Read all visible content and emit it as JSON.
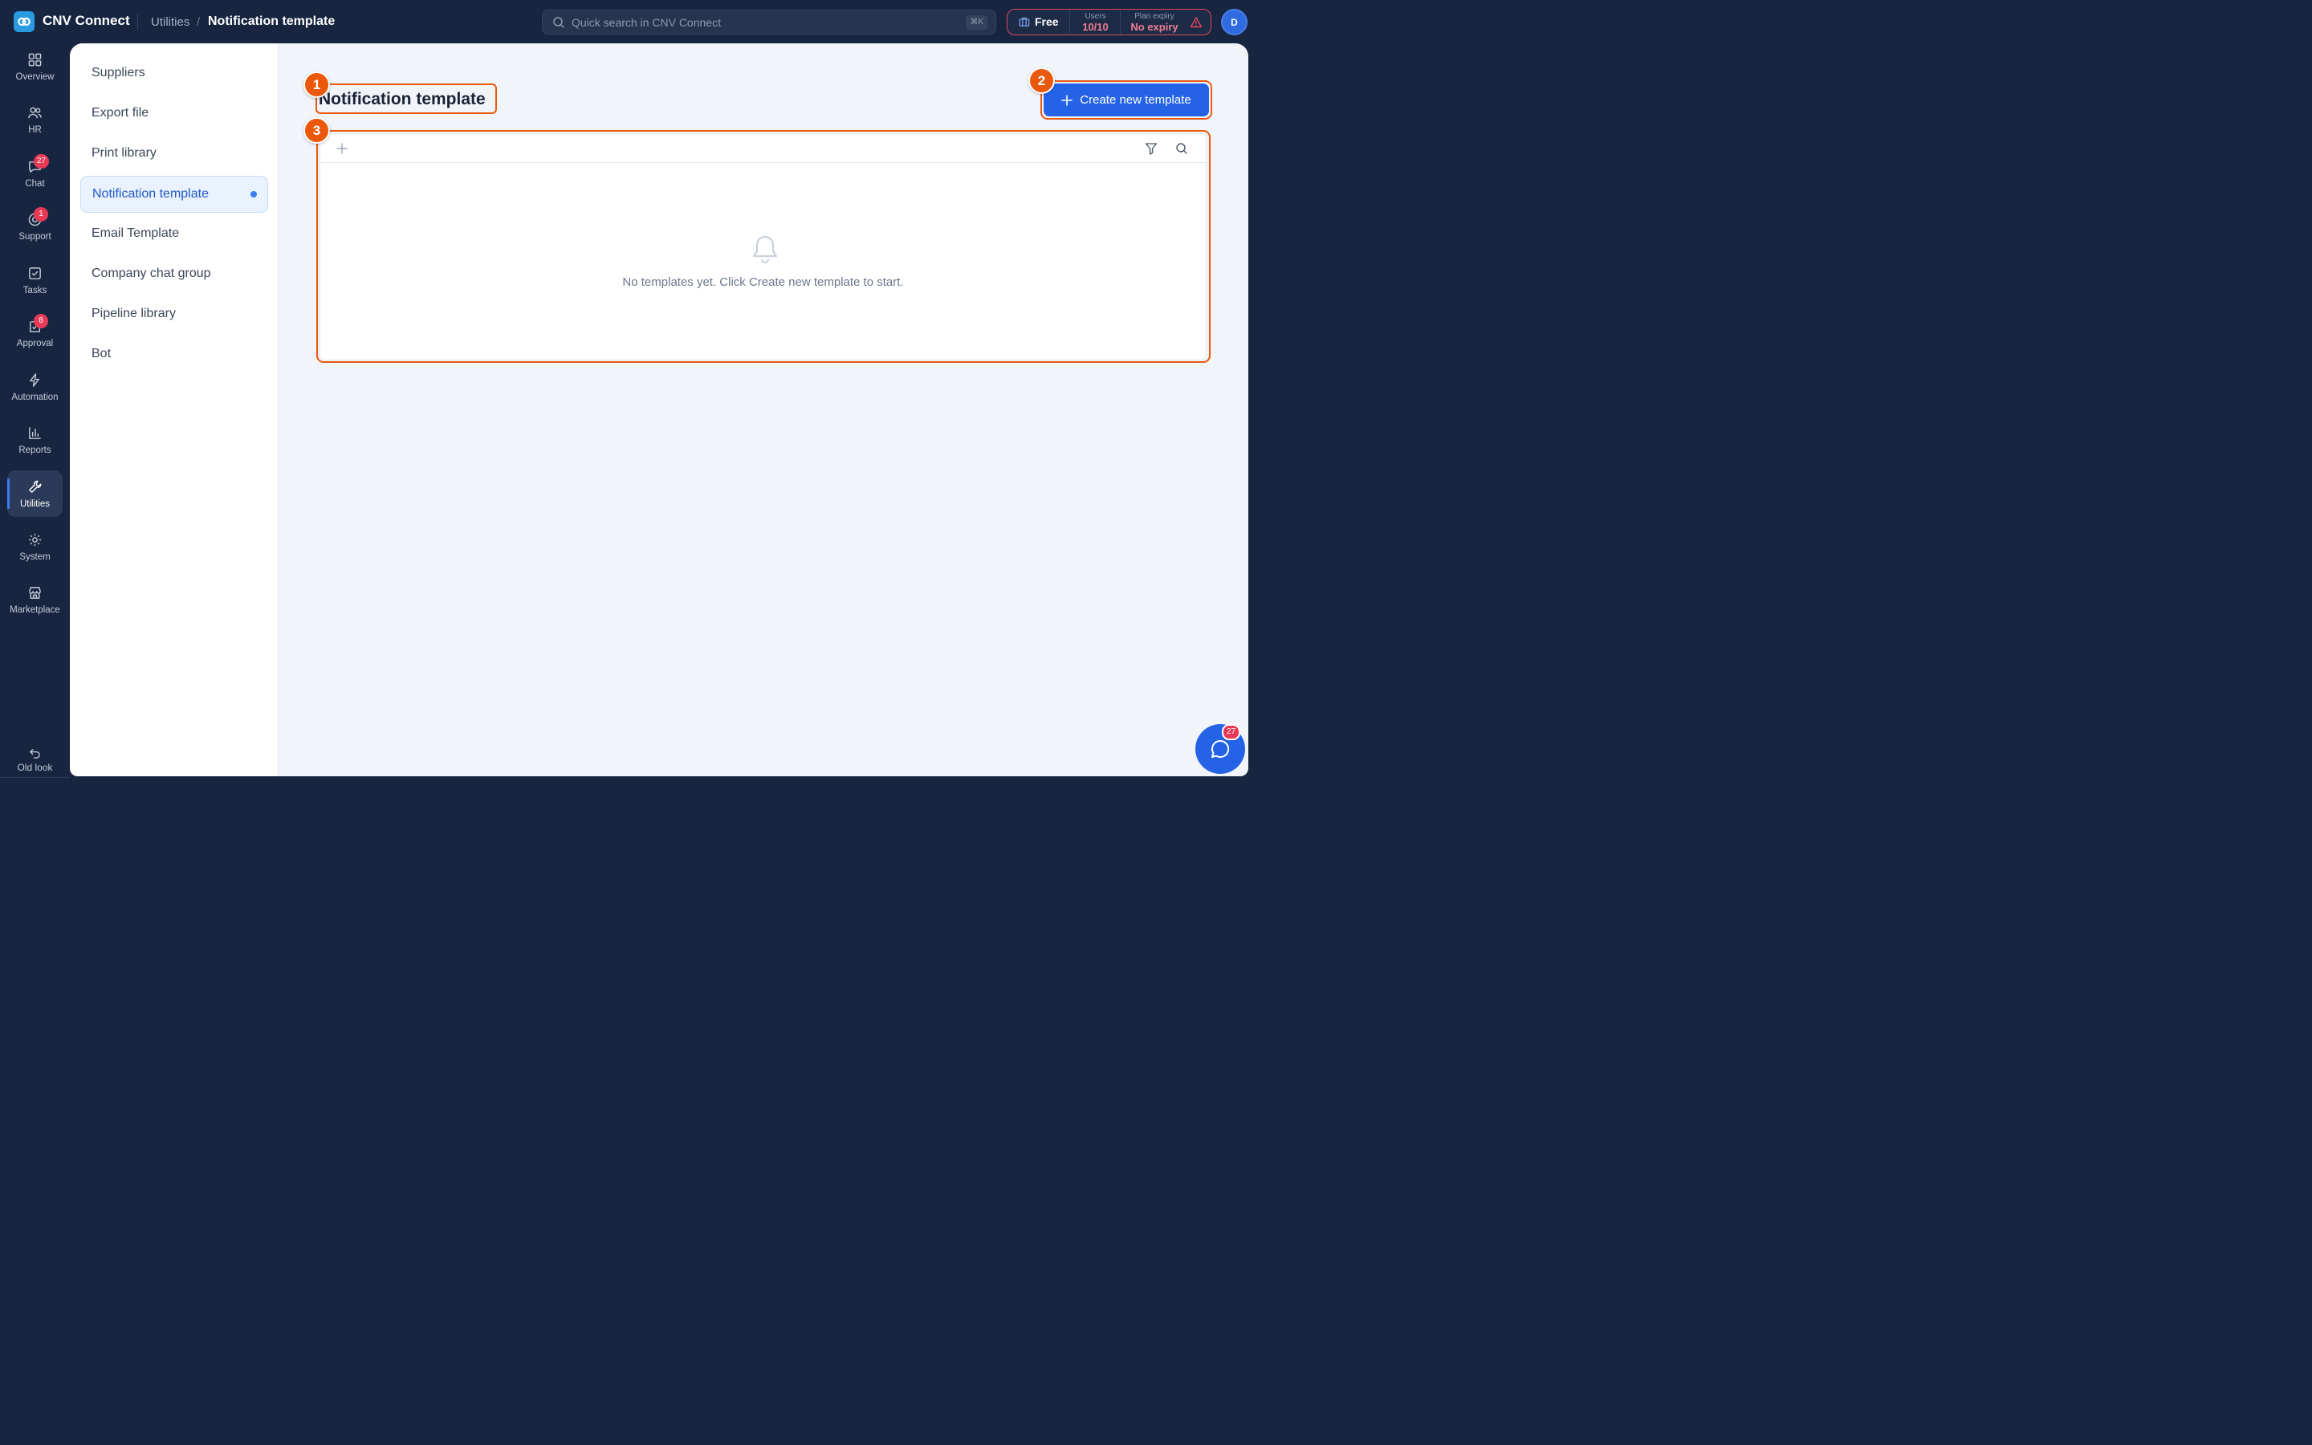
{
  "app": {
    "title": "CNV Connect"
  },
  "breadcrumb": {
    "parent": "Utilities",
    "separator": "/",
    "current": "Notification template"
  },
  "search": {
    "placeholder": "Quick search in CNV Connect",
    "shortcut": "⌘K"
  },
  "plan": {
    "tier": "Free",
    "users_label": "Users",
    "users_value": "10/10",
    "expiry_label": "Plan expiry",
    "expiry_value": "No expiry",
    "alert_color": "#e0465c"
  },
  "user": {
    "initial": "D"
  },
  "rail": {
    "items": [
      {
        "label": "Overview",
        "icon": "grid-icon"
      },
      {
        "label": "HR",
        "icon": "users-icon"
      },
      {
        "label": "Chat",
        "icon": "chat-icon",
        "badge": "27"
      },
      {
        "label": "Support",
        "icon": "lifebuoy-icon",
        "badge": "1"
      },
      {
        "label": "Tasks",
        "icon": "checkbox-icon"
      },
      {
        "label": "Approval",
        "icon": "approval-icon",
        "badge": "8"
      },
      {
        "label": "Automation",
        "icon": "bolt-icon"
      },
      {
        "label": "Reports",
        "icon": "bar-chart-icon"
      },
      {
        "label": "Utilities",
        "icon": "wrench-icon",
        "active": true
      },
      {
        "label": "System",
        "icon": "gear-icon"
      },
      {
        "label": "Marketplace",
        "icon": "store-icon"
      }
    ],
    "old_look": "Old look"
  },
  "subnav": {
    "items": [
      {
        "label": "Suppliers"
      },
      {
        "label": "Export file"
      },
      {
        "label": "Print library"
      },
      {
        "label": "Notification template",
        "active": true
      },
      {
        "label": "Email Template"
      },
      {
        "label": "Company chat group"
      },
      {
        "label": "Pipeline library"
      },
      {
        "label": "Bot"
      }
    ]
  },
  "main": {
    "title": "Notification template",
    "create_button": "Create new template",
    "empty_message": "No templates yet. Click Create new template to start."
  },
  "markers": [
    "1",
    "2",
    "3"
  ],
  "chat_fab": {
    "badge": "27"
  },
  "colors": {
    "accent": "#2462e6",
    "highlight": "#ea580c",
    "badge": "#e83a56"
  }
}
